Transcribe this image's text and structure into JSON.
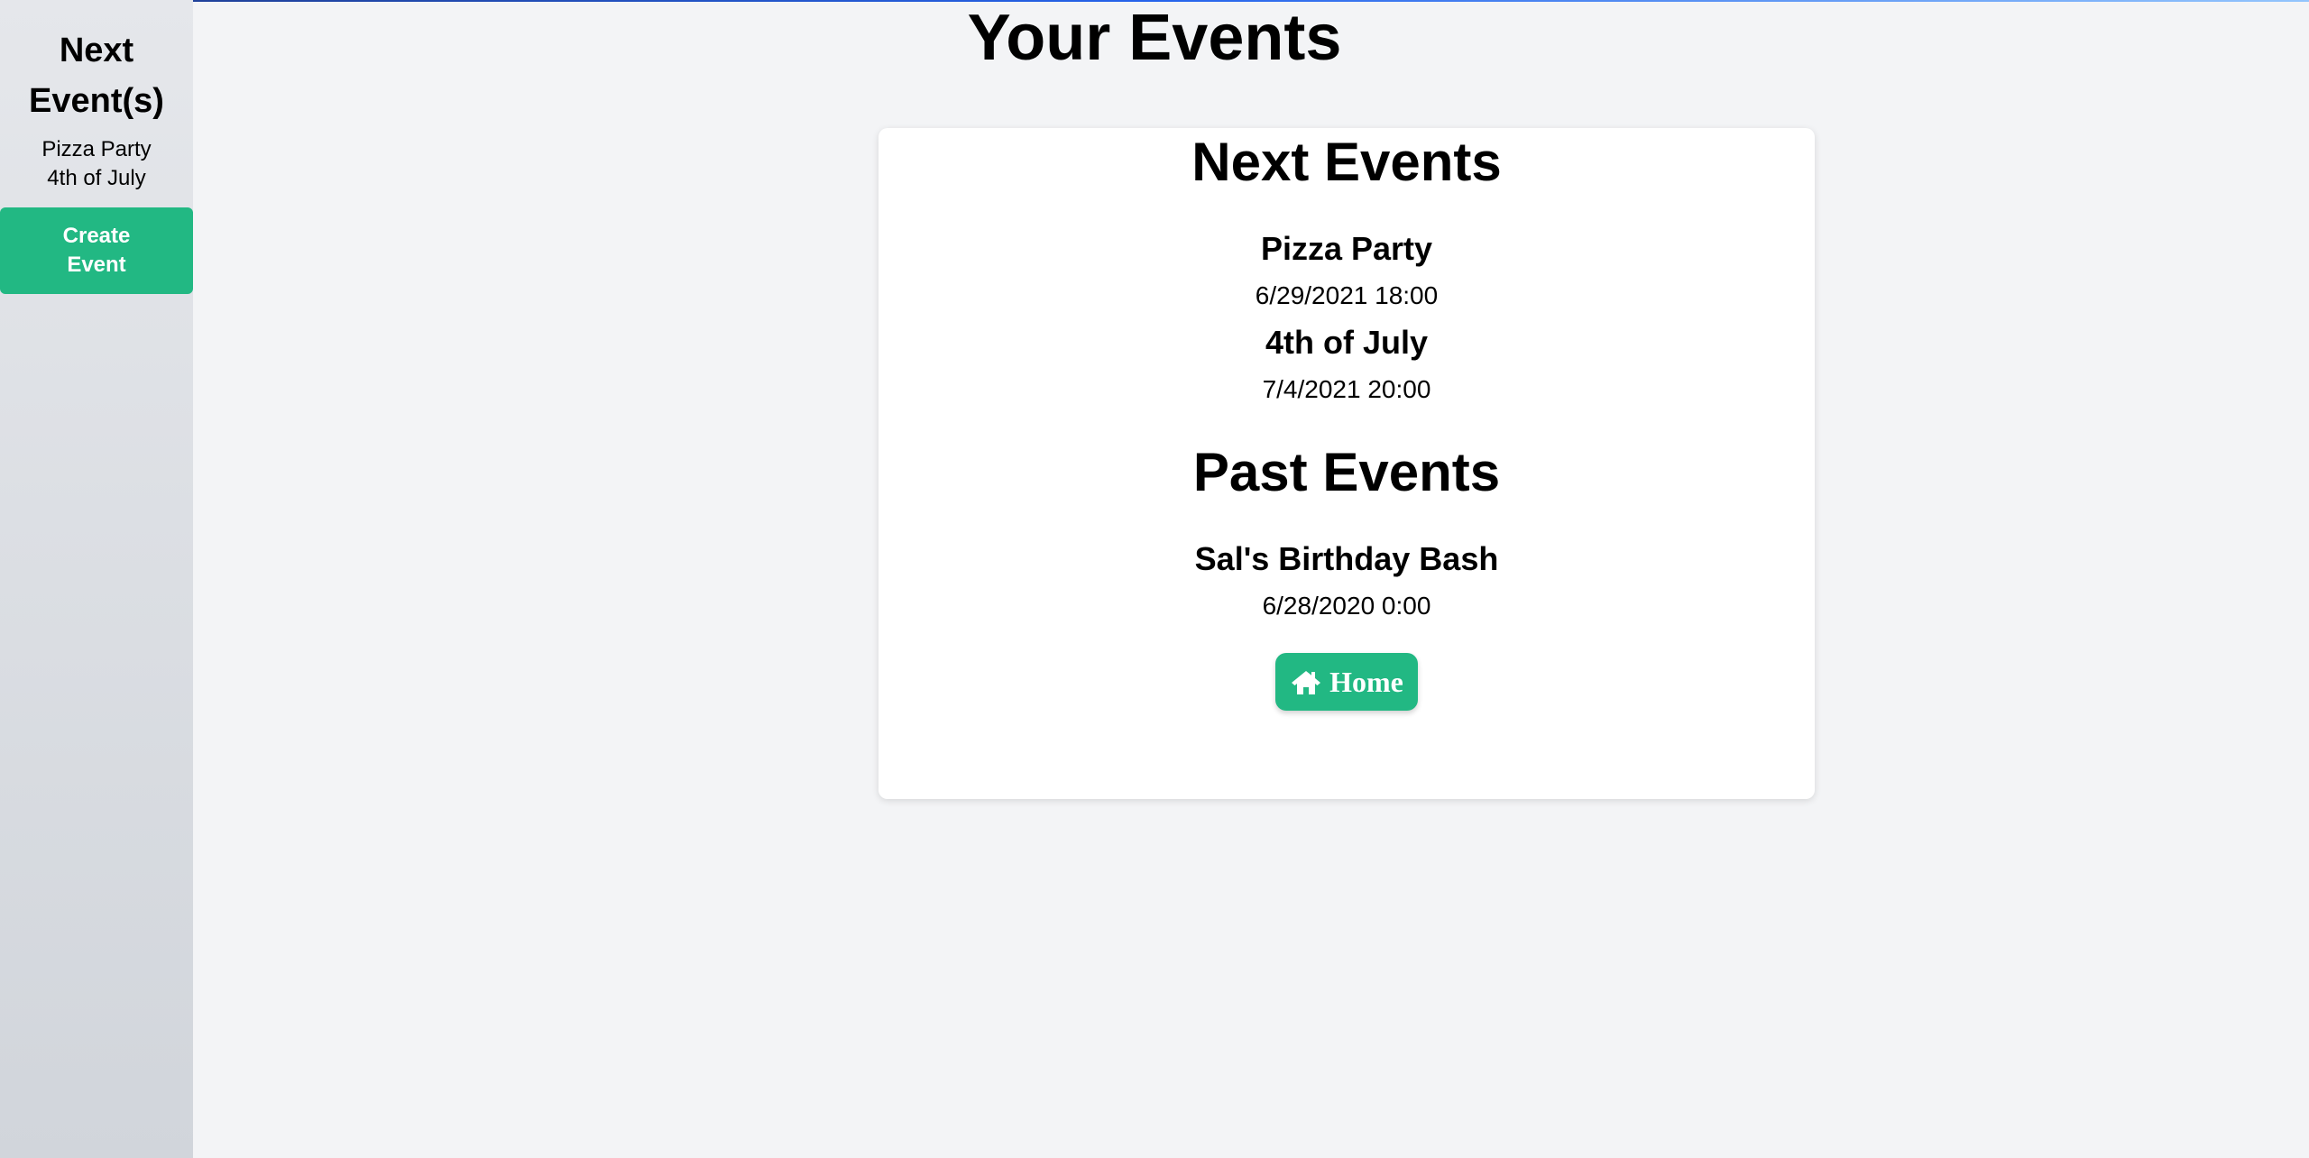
{
  "sidebar": {
    "title": "Next Event(s)",
    "items": [
      {
        "label": "Pizza Party"
      },
      {
        "label": "4th of July"
      }
    ],
    "create_button": "Create Event"
  },
  "main": {
    "title": "Your Events",
    "next_section": {
      "title": "Next Events",
      "events": [
        {
          "name": "Pizza Party",
          "date": "6/29/2021 18:00"
        },
        {
          "name": "4th of July",
          "date": "7/4/2021 20:00"
        }
      ]
    },
    "past_section": {
      "title": "Past Events",
      "events": [
        {
          "name": "Sal's Birthday Bash",
          "date": "6/28/2020 0:00"
        }
      ]
    },
    "home_button": "Home"
  },
  "colors": {
    "accent": "#22b883",
    "background": "#f3f4f6",
    "card": "#ffffff"
  },
  "icons": {
    "home_button_icon": "home-icon"
  }
}
